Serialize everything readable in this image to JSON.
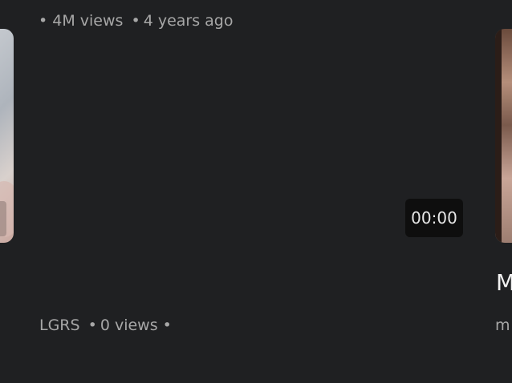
{
  "cards": {
    "top_video": {
      "views": "4M views",
      "age": "4 years ago"
    },
    "middle_video": {
      "duration": "00:00",
      "channel": "LGRS",
      "views": "0 views"
    },
    "right_video": {
      "title_fragment": "M",
      "channel_fragment": "m"
    }
  },
  "separator": "•"
}
